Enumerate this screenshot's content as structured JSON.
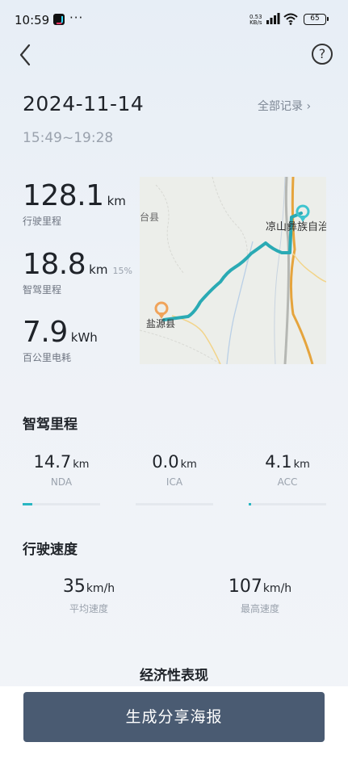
{
  "status_bar": {
    "time": "10:59",
    "dots": "···",
    "net_speed_value": "0.53",
    "net_speed_unit": "KB/s",
    "battery": "65"
  },
  "header": {
    "date": "2024-11-14",
    "all_records_label": "全部记录 ›",
    "time_range": "15:49~19:28"
  },
  "stats": {
    "distance": {
      "value": "128.1",
      "unit": "km",
      "label": "行驶里程"
    },
    "smart_distance": {
      "value": "18.8",
      "unit": "km",
      "percent": "15%",
      "label": "智驾里程"
    },
    "consumption": {
      "value": "7.9",
      "unit": "kWh",
      "label": "百公里电耗"
    }
  },
  "map": {
    "place_top": "凉山彝族自治",
    "place_left_top": "台县",
    "place_start": "盐源县"
  },
  "smart_driving": {
    "title": "智驾里程",
    "items": [
      {
        "value": "14.7",
        "unit": "km",
        "name": "NDA",
        "fraction": 0.12
      },
      {
        "value": "0.0",
        "unit": "km",
        "name": "ICA",
        "fraction": 0.0
      },
      {
        "value": "4.1",
        "unit": "km",
        "name": "ACC",
        "fraction": 0.03
      }
    ]
  },
  "speed": {
    "title": "行驶速度",
    "avg": {
      "value": "35",
      "unit": "km/h",
      "name": "平均速度"
    },
    "max": {
      "value": "107",
      "unit": "km/h",
      "name": "最高速度"
    }
  },
  "economy": {
    "title": "经济性表现"
  },
  "share_button": {
    "label": "生成分享海报"
  },
  "colors": {
    "accent": "#29b6c2",
    "button": "#4a5b72",
    "start_pin": "#f0a35a"
  }
}
